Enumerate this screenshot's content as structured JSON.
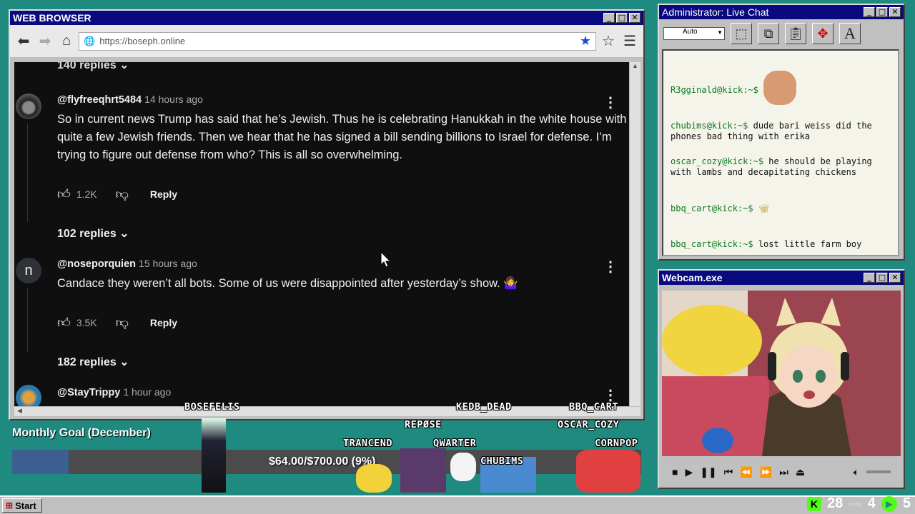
{
  "browser": {
    "title": "WEB BROWSER",
    "url": "https://boseph.online"
  },
  "comments": [
    {
      "handle": "@flyfreeqhrt5484",
      "time": "14 hours ago",
      "text": "So in current news Trump has said that he’s Jewish. Thus he is celebrating Hanukkah in the white house with quite a few Jewish friends. Then we hear that he has signed a bill sending billions to Israel for defense. I’m trying to figure out defense from who?  This is all so overwhelming.",
      "likes": "1.2K",
      "reply_label": "Reply",
      "replies": "102 replies"
    },
    {
      "avatar_letter": "n",
      "handle": "@noseporquien",
      "time": "15 hours ago",
      "text": "Candace they weren’t all bots. Some of us were disappointed after yesterday’s show. 🤷‍♀️",
      "likes": "3.5K",
      "reply_label": "Reply",
      "replies": "182 replies"
    },
    {
      "handle": "@StayTrippy",
      "time": "1 hour ago"
    }
  ],
  "top_replies": "140 replies",
  "chat": {
    "title": "Administrator: Live Chat",
    "select_value": "Auto",
    "messages": [
      {
        "user": "R3gginald@kick:~$",
        "text": ""
      },
      {
        "user": "chubims@kick:~$",
        "text": "dude bari weiss did the phones bad thing with erika"
      },
      {
        "user": "oscar_cozy@kick:~$",
        "text": "he should be playing with lambs and decapitating chickens"
      },
      {
        "user": "bbq_cart@kick:~$",
        "text": ""
      },
      {
        "user": "bbq_cart@kick:~$",
        "text": "lost little farm boy"
      }
    ]
  },
  "webcam": {
    "title": "Webcam.exe"
  },
  "goal": {
    "title": "Monthly Goal (December)",
    "amount": "$64.00/$700.00 (9%)",
    "progress": 0.09
  },
  "viewers": [
    "BOSEFELIS",
    "REPØSE",
    "KEDB_DEAD",
    "BBQ_CART",
    "TRANCEND",
    "QWARTER",
    "OSCAR_COZY",
    "CHUBIMS",
    "CORNPOP"
  ],
  "taskbar": {
    "start": "Start",
    "kick_count": "28",
    "cozy_label": "cozy",
    "left_num": "4",
    "right_num": "5"
  },
  "colors": {
    "titlebar": "#0a0a80",
    "desktop": "#1f8a80",
    "kick": "#53fc18"
  }
}
